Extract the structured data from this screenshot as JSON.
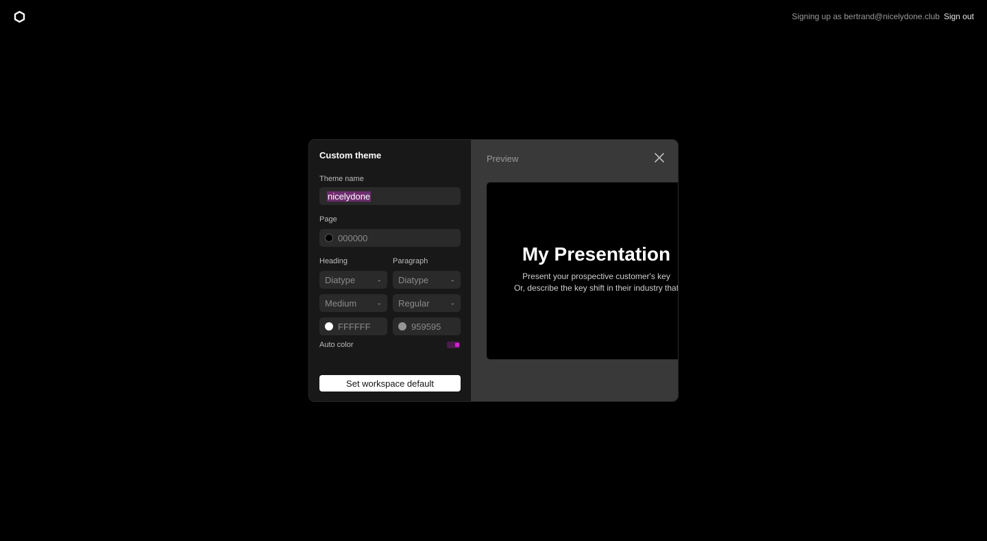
{
  "topbar": {
    "signing_up_text": "Signing up as bertrand@nicelydone.club",
    "sign_out_label": "Sign out"
  },
  "modal": {
    "title": "Custom theme",
    "theme_name": {
      "label": "Theme name",
      "value": "nicelydone"
    },
    "page": {
      "label": "Page",
      "color_value": "000000",
      "swatch_color": "#000000"
    },
    "heading": {
      "label": "Heading",
      "font": "Diatype",
      "weight": "Medium",
      "color_value": "FFFFFF",
      "swatch_color": "#FFFFFF"
    },
    "paragraph": {
      "label": "Paragraph",
      "font": "Diatype",
      "weight": "Regular",
      "color_value": "959595",
      "swatch_color": "#959595"
    },
    "auto_color": {
      "label": "Auto color",
      "enabled": true,
      "accent": "#d41fd4"
    },
    "set_default_label": "Set workspace default",
    "preview": {
      "label": "Preview",
      "slide_title": "My Presentation",
      "slide_line1": "Present your prospective customer's key",
      "slide_line2": "Or, describe the key shift in their industry that"
    }
  },
  "icons": [
    "logo-icon",
    "chevron-down-icon",
    "close-icon"
  ]
}
